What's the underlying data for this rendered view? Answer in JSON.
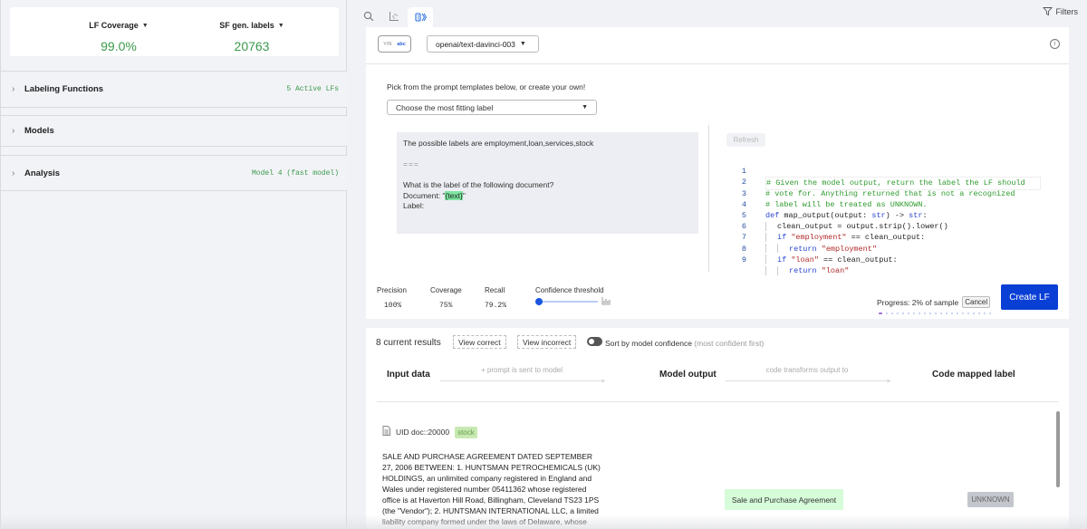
{
  "sidebar": {
    "stats": [
      {
        "label": "LF Coverage",
        "value": "99.0%"
      },
      {
        "label": "SF gen. labels",
        "value": "20763"
      }
    ],
    "sections": [
      {
        "title": "Labeling Functions",
        "meta": "5 Active LFs"
      },
      {
        "title": "Models",
        "meta": ""
      },
      {
        "title": "Analysis",
        "meta": "Model 4 (fast model)"
      }
    ]
  },
  "toolbar": {
    "icons": [
      "search-icon",
      "scatter-plot-icon",
      "prompt-builder-icon"
    ],
    "active_icon": "prompt-builder-icon",
    "filters_label": "Filters"
  },
  "prompt_panel": {
    "yn_label": "Y/N",
    "abc_label": "abc",
    "model_select": "openai/text-davinci-003",
    "pick_text": "Pick from the prompt templates below, or create your own!",
    "template_select": "Choose the most fitting label",
    "prompt": {
      "line1": "The possible labels are employment,loan,services,stock",
      "separator": "===",
      "line2": "What is the label of the following document?",
      "doc_prefix": "Document: \"",
      "doc_var": "{text}",
      "doc_suffix": "\"",
      "line3": "Label:"
    },
    "refresh_label": "Refresh",
    "code_lines": [
      {
        "n": "1",
        "text": "# Given the model output, return the label the LF should"
      },
      {
        "n": "2",
        "text": "# vote for. Anything returned that is not a recognized"
      },
      {
        "n": "3",
        "text": "# label will be treated as UNKNOWN."
      },
      {
        "n": "4",
        "kw": "def",
        "text": " map_output(output: ",
        "type1": "str",
        "mid": ") -> ",
        "type2": "str",
        "end": ":"
      },
      {
        "n": "5",
        "text": "clean_output = output.strip().lower()"
      },
      {
        "n": "6",
        "kw": "if",
        "str": "\"employment\"",
        "text": " == clean_output:"
      },
      {
        "n": "7",
        "kw": "return",
        "str": "\"employment\""
      },
      {
        "n": "8",
        "kw": "if",
        "str": "\"loan\"",
        "text": " == clean_output:"
      },
      {
        "n": "9",
        "kw": "return",
        "str": "\"loan\""
      }
    ],
    "metrics": [
      {
        "label": "Precision",
        "value": "100%"
      },
      {
        "label": "Coverage",
        "value": "75%"
      },
      {
        "label": "Recall",
        "value": "79.2%"
      }
    ],
    "confidence_label": "Confidence threshold",
    "confidence_threshold": 0,
    "progress_percent": 2,
    "progress_text": "Progress: 2% of sample",
    "cancel_label": "Cancel",
    "create_label": "Create LF"
  },
  "results": {
    "count_label": "8 current results",
    "view_correct": "View correct",
    "view_incorrect": "View incorrect",
    "sort_label": "Sort by model confidence",
    "sort_hint": "(most confident first)",
    "sort_enabled": true,
    "columns": [
      "Input data",
      "Model output",
      "Code mapped label"
    ],
    "flow_1": "+ prompt is sent to model",
    "flow_2": "code transforms output to",
    "rows": [
      {
        "uid": "UID doc::20000",
        "label": "stock",
        "text": "SALE AND PURCHASE AGREEMENT DATED SEPTEMBER 27, 2006 BETWEEN: 1. HUNTSMAN PETROCHEMICALS (UK) HOLDINGS, an unlimited company registered in England and Wales under registered number 05411362 whose registered office is at Haverton Hill Road, Billingham, Cleveland TS23 1PS (the \"Vendor\"); 2. HUNTSMAN INTERNATIONAL LLC, a limited liability company formed under the laws of Delaware, whose",
        "model_output": "Sale and Purchase Agreement",
        "mapped_label": "UNKNOWN"
      }
    ]
  }
}
